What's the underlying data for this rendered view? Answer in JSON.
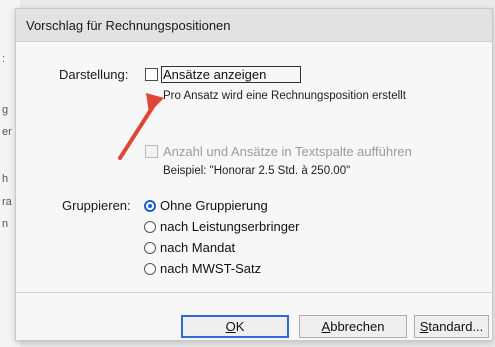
{
  "background": {
    "fragments": [
      ":",
      "g",
      "er",
      "h",
      "ra",
      "n"
    ]
  },
  "dialog": {
    "title": "Vorschlag für Rechnungspositionen",
    "darstellung": {
      "label": "Darstellung:",
      "show_rates": {
        "label": "Ansätze anzeigen",
        "checked": false,
        "hint": "Pro Ansatz wird  eine Rechnungsposition erstellt"
      },
      "list_in_text": {
        "label": "Anzahl und Ansätze in Textspalte aufführen",
        "enabled": false,
        "example": "Beispiel: \"Honorar 2.5 Std. à 250.00\""
      }
    },
    "gruppieren": {
      "label": "Gruppieren:",
      "options": [
        {
          "label": "Ohne Gruppierung",
          "selected": true
        },
        {
          "label": "nach Leistungserbringer",
          "selected": false
        },
        {
          "label": "nach Mandat",
          "selected": false
        },
        {
          "label": "nach MWST-Satz",
          "selected": false
        }
      ]
    },
    "buttons": {
      "ok": {
        "mnemonic": "O",
        "rest": "K"
      },
      "cancel": {
        "mnemonic": "A",
        "rest": "bbrechen"
      },
      "standard": {
        "mnemonic": "S",
        "rest": "tandard..."
      }
    }
  },
  "colors": {
    "accent": "#1d5fd0",
    "arrow": "#e04535"
  },
  "icons": {
    "annotation": "red-arrow-icon"
  }
}
